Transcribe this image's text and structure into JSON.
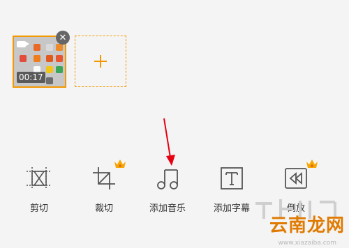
{
  "clips": {
    "duration": "00:17",
    "close_icon": "close-icon",
    "add_icon": "plus-icon",
    "accent": "#f39800"
  },
  "tools": [
    {
      "label": "剪切",
      "icon": "cut-icon",
      "premium": false
    },
    {
      "label": "裁切",
      "icon": "crop-icon",
      "premium": true
    },
    {
      "label": "添加音乐",
      "icon": "music-note-icon",
      "premium": false
    },
    {
      "label": "添加字幕",
      "icon": "text-icon",
      "premium": false
    },
    {
      "label": "倒放",
      "icon": "rewind-icon",
      "premium": true
    }
  ],
  "watermark": {
    "brand": "云南龙网",
    "url": "www.xiazaiba.com"
  },
  "colors": {
    "background": "#f4f4f4",
    "annotation_arrow": "#e60012",
    "crown": "#f5a800"
  }
}
